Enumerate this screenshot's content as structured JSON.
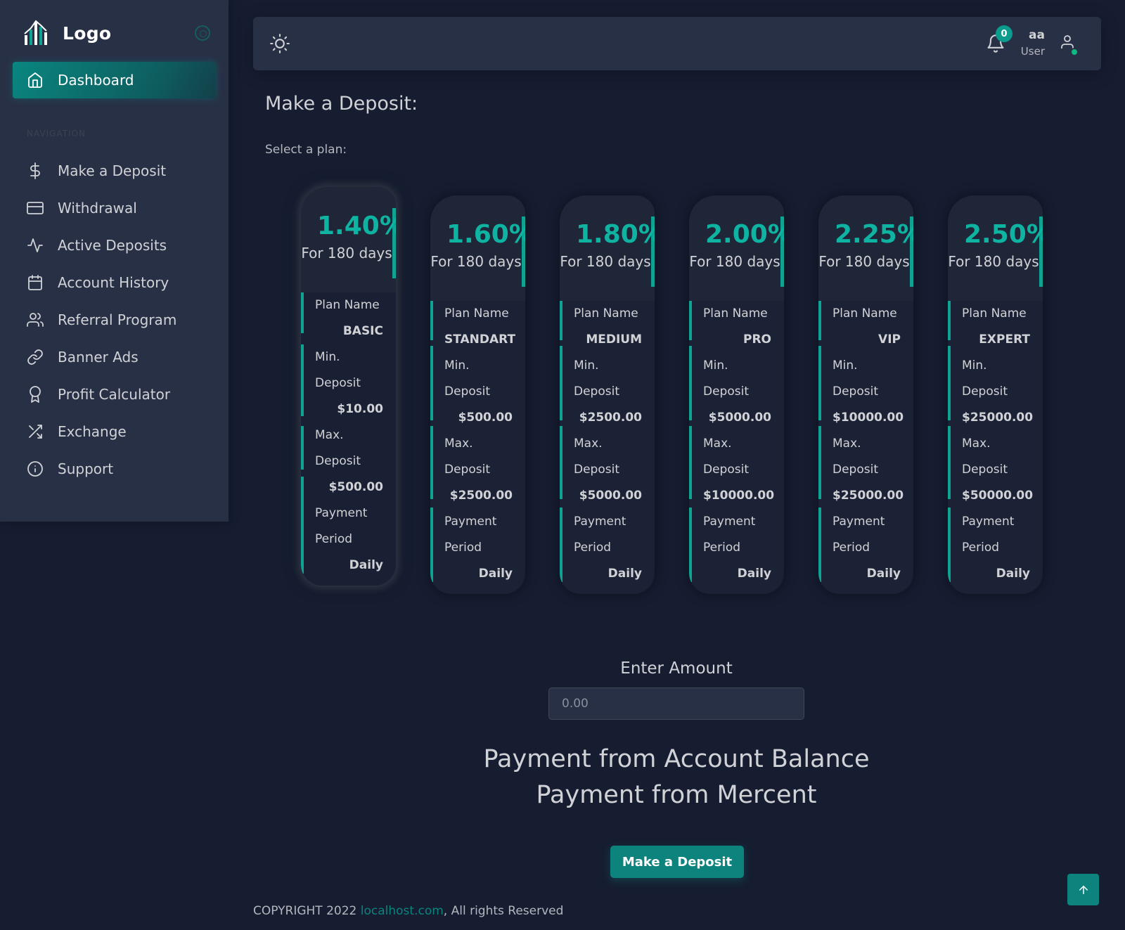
{
  "brand": {
    "name": "Logo"
  },
  "sidebar": {
    "active": {
      "label": "Dashboard",
      "icon": "home-icon"
    },
    "header": "NAVIGATION",
    "items": [
      {
        "label": "Make a Deposit",
        "icon": "dollar-icon"
      },
      {
        "label": "Withdrawal",
        "icon": "credit-card-icon"
      },
      {
        "label": "Active Deposits",
        "icon": "activity-icon"
      },
      {
        "label": "Account History",
        "icon": "calendar-icon"
      },
      {
        "label": "Referral Program",
        "icon": "users-icon"
      },
      {
        "label": "Banner Ads",
        "icon": "link-icon"
      },
      {
        "label": "Profit Calculator",
        "icon": "award-icon"
      },
      {
        "label": "Exchange",
        "icon": "shuffle-icon"
      },
      {
        "label": "Support",
        "icon": "info-icon"
      }
    ]
  },
  "header": {
    "notification_count": "0",
    "user_name": "aa",
    "user_role": "User"
  },
  "main": {
    "title": "Make a Deposit:",
    "select_plan": "Select a plan:",
    "plans": [
      {
        "rate": "1.40%",
        "days": "For 180 days",
        "plan_name_label": "Plan Name",
        "plan_name": "BASIC",
        "min_label_1": "Min.",
        "min_label_2": "Deposit",
        "min": "$10.00",
        "max_label_1": "Max.",
        "max_label_2": "Deposit",
        "max": "$500.00",
        "period_label_1": "Payment",
        "period_label_2": "Period",
        "period": "Daily",
        "selected": true
      },
      {
        "rate": "1.60%",
        "days": "For 180 days",
        "plan_name_label": "Plan Name",
        "plan_name": "STANDART",
        "min_label_1": "Min.",
        "min_label_2": "Deposit",
        "min": "$500.00",
        "max_label_1": "Max.",
        "max_label_2": "Deposit",
        "max": "$2500.00",
        "period_label_1": "Payment",
        "period_label_2": "Period",
        "period": "Daily",
        "selected": false
      },
      {
        "rate": "1.80%",
        "days": "For 180 days",
        "plan_name_label": "Plan Name",
        "plan_name": "MEDIUM",
        "min_label_1": "Min.",
        "min_label_2": "Deposit",
        "min": "$2500.00",
        "max_label_1": "Max.",
        "max_label_2": "Deposit",
        "max": "$5000.00",
        "period_label_1": "Payment",
        "period_label_2": "Period",
        "period": "Daily",
        "selected": false
      },
      {
        "rate": "2.00%",
        "days": "For 180 days",
        "plan_name_label": "Plan Name",
        "plan_name": "PRO",
        "min_label_1": "Min.",
        "min_label_2": "Deposit",
        "min": "$5000.00",
        "max_label_1": "Max.",
        "max_label_2": "Deposit",
        "max": "$10000.00",
        "period_label_1": "Payment",
        "period_label_2": "Period",
        "period": "Daily",
        "selected": false
      },
      {
        "rate": "2.25%",
        "days": "For 180 days",
        "plan_name_label": "Plan Name",
        "plan_name": "VIP",
        "min_label_1": "Min.",
        "min_label_2": "Deposit",
        "min": "$10000.00",
        "max_label_1": "Max.",
        "max_label_2": "Deposit",
        "max": "$25000.00",
        "period_label_1": "Payment",
        "period_label_2": "Period",
        "period": "Daily",
        "selected": false
      },
      {
        "rate": "2.50%",
        "days": "For 180 days",
        "plan_name_label": "Plan Name",
        "plan_name": "EXPERT",
        "min_label_1": "Min.",
        "min_label_2": "Deposit",
        "min": "$25000.00",
        "max_label_1": "Max.",
        "max_label_2": "Deposit",
        "max": "$50000.00",
        "period_label_1": "Payment",
        "period_label_2": "Period",
        "period": "Daily",
        "selected": false
      }
    ],
    "amount_label": "Enter Amount",
    "amount_value": "0.00",
    "payment_balance": "Payment from Account Balance",
    "payment_mercent": "Payment from Mercent",
    "deposit_button": "Make a Deposit"
  },
  "footer": {
    "prefix": "COPYRIGHT 2022 ",
    "link": "localhost.com",
    "suffix": ", All rights Reserved"
  },
  "colors": {
    "background": "#161d31",
    "panel": "#283046",
    "accent": "#0c837d",
    "rate": "#0fb3a2"
  }
}
